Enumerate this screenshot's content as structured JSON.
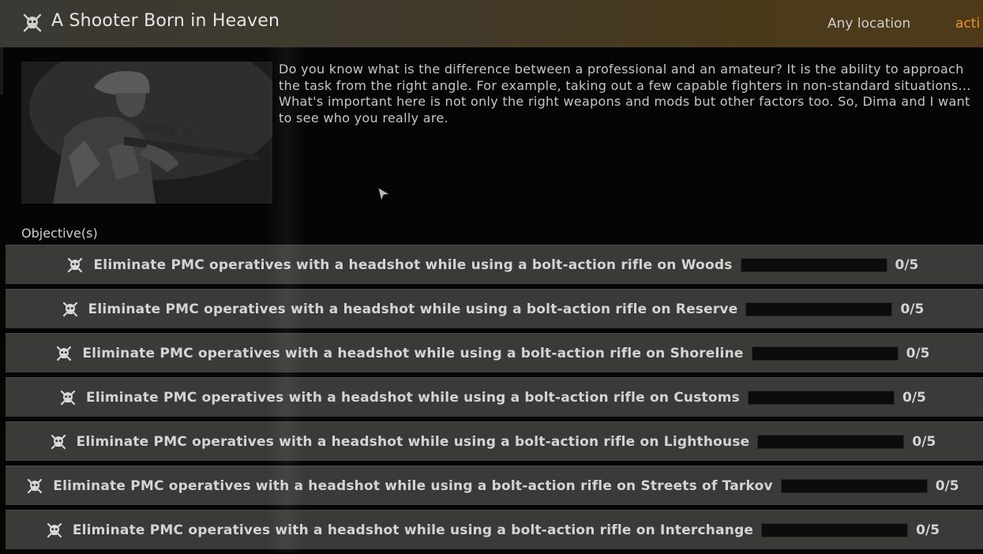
{
  "header": {
    "title": "A Shooter Born in Heaven",
    "location": "Any location",
    "status": "acti"
  },
  "description": [
    "Do you know what is the difference between a professional and an amateur? It is the ability to approach",
    "the task from the right angle. For example, taking out a few capable fighters in non-standard situations...",
    "What's important here is not only the right weapons and mods but other factors too. So, Dima and I want",
    "to see who you really are."
  ],
  "objectives_label": "Objective(s)",
  "objectives": [
    {
      "text": "Eliminate PMC operatives with a headshot while using a bolt-action rifle on Woods",
      "progress": 0,
      "count": "0/5"
    },
    {
      "text": "Eliminate PMC operatives with a headshot while using a bolt-action rifle on Reserve",
      "progress": 0,
      "count": "0/5"
    },
    {
      "text": "Eliminate PMC operatives with a headshot while using a bolt-action rifle on Shoreline",
      "progress": 0,
      "count": "0/5"
    },
    {
      "text": "Eliminate PMC operatives with a headshot while using a bolt-action rifle on Customs",
      "progress": 0,
      "count": "0/5"
    },
    {
      "text": "Eliminate PMC operatives with a headshot while using a bolt-action rifle on Lighthouse",
      "progress": 0,
      "count": "0/5"
    },
    {
      "text": "Eliminate PMC operatives with a headshot while using a bolt-action rifle on Streets of Tarkov",
      "progress": 0,
      "count": "0/5"
    },
    {
      "text": "Eliminate PMC operatives with a headshot while using a bolt-action rifle on Interchange",
      "progress": 0,
      "count": "0/5"
    }
  ],
  "icons": {
    "header": "skull-crossbones-icon",
    "objective": "skull-crossbones-icon",
    "cursor": "mouse-cursor-icon"
  },
  "colors": {
    "status": "#e8952a",
    "objective_bg": "#3a3a39",
    "header_bg": "#4a3a1c"
  }
}
